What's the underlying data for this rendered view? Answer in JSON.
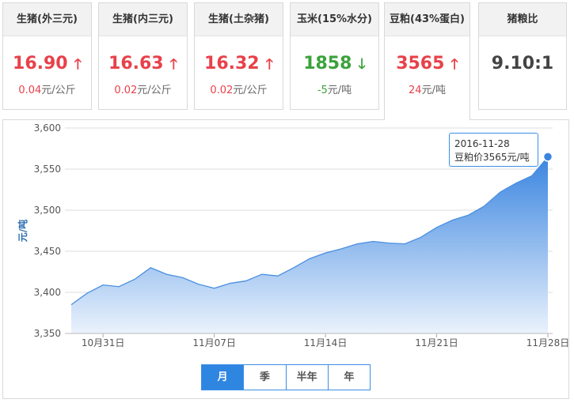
{
  "cards": [
    {
      "title": "生猪(外三元)",
      "price": "16.90",
      "change": "0.04",
      "unit": "元/公斤",
      "dir": "up"
    },
    {
      "title": "生猪(内三元)",
      "price": "16.63",
      "change": "0.02",
      "unit": "元/公斤",
      "dir": "up"
    },
    {
      "title": "生猪(土杂猪)",
      "price": "16.32",
      "change": "0.02",
      "unit": "元/公斤",
      "dir": "up"
    },
    {
      "title": "玉米(15%水分)",
      "price": "1858",
      "change": "-5",
      "unit": "元/吨",
      "dir": "down"
    },
    {
      "title": "豆粕(43%蛋白)",
      "price": "3565",
      "change": "24",
      "unit": "元/吨",
      "dir": "up"
    },
    {
      "title": "猪粮比",
      "price": "9.10:1",
      "change": "",
      "unit": "",
      "dir": "none"
    }
  ],
  "colors": {
    "up": "#e8414a",
    "down": "#3aa23a",
    "accent": "#2f86e1",
    "area_top": "#3a85e0",
    "area_bottom": "#eaf2fc"
  },
  "chart_data": {
    "type": "area",
    "ylabel": "元/吨",
    "ylim": [
      3350,
      3600
    ],
    "yticks": [
      3350,
      3400,
      3450,
      3500,
      3550,
      3600
    ],
    "yticklabels": [
      "3,350",
      "3,400",
      "3,450",
      "3,500",
      "3,550",
      "3,600"
    ],
    "xtick_labels": [
      "10月31日",
      "11月07日",
      "11月14日",
      "11月21日",
      "11月28日"
    ],
    "x_dates": [
      "10-29",
      "10-30",
      "10-31",
      "11-01",
      "11-02",
      "11-03",
      "11-04",
      "11-05",
      "11-06",
      "11-07",
      "11-08",
      "11-09",
      "11-10",
      "11-11",
      "11-12",
      "11-13",
      "11-14",
      "11-15",
      "11-16",
      "11-17",
      "11-18",
      "11-19",
      "11-20",
      "11-21",
      "11-22",
      "11-23",
      "11-24",
      "11-25",
      "11-26",
      "11-27",
      "11-28"
    ],
    "values": [
      3385,
      3399,
      3409,
      3407,
      3416,
      3430,
      3422,
      3418,
      3410,
      3405,
      3411,
      3414,
      3422,
      3420,
      3430,
      3441,
      3448,
      3453,
      3459,
      3462,
      3460,
      3459,
      3467,
      3479,
      3488,
      3494,
      3505,
      3522,
      3533,
      3542,
      3565
    ],
    "grid": true,
    "series": [
      {
        "values_ref": "values"
      }
    ]
  },
  "tooltip": {
    "date": "2016-11-28",
    "text": "豆粕价3565元/吨"
  },
  "range_tabs": [
    {
      "label": "月",
      "active": true
    },
    {
      "label": "季",
      "active": false
    },
    {
      "label": "半年",
      "active": false
    },
    {
      "label": "年",
      "active": false
    }
  ]
}
